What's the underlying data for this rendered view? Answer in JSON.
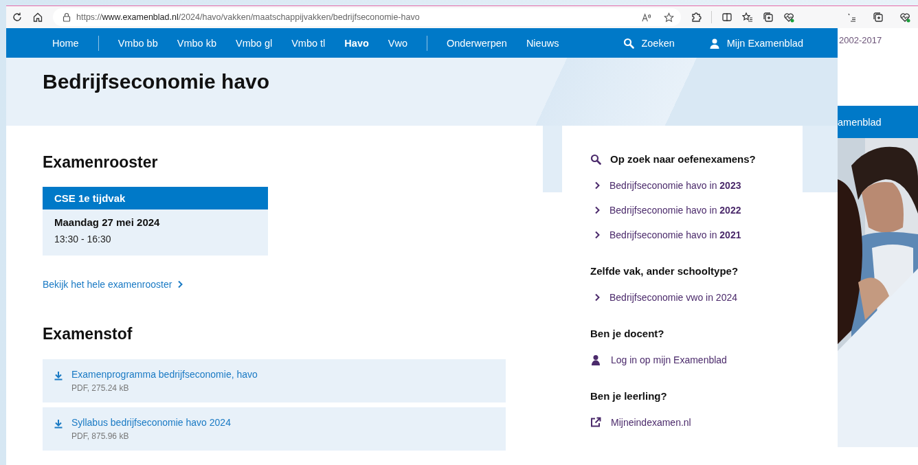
{
  "browser": {
    "url_scheme": "https://",
    "url_host": "www.examenblad.nl",
    "url_path": "/2024/havo/vakken/maatschappijvakken/bedrijfseconomie-havo"
  },
  "nav": {
    "groups": [
      [
        {
          "label": "Home",
          "selected": false
        }
      ],
      [
        {
          "label": "Vmbo bb",
          "selected": false
        },
        {
          "label": "Vmbo kb",
          "selected": false
        },
        {
          "label": "Vmbo gl",
          "selected": false
        },
        {
          "label": "Vmbo tl",
          "selected": false
        },
        {
          "label": "Havo",
          "selected": true
        },
        {
          "label": "Vwo",
          "selected": false
        }
      ],
      [
        {
          "label": "Onderwerpen",
          "selected": false
        },
        {
          "label": "Nieuws",
          "selected": false
        }
      ]
    ],
    "search": "Zoeken",
    "account": "Mijn Examenblad"
  },
  "title": "Bedrijfseconomie havo",
  "schedule": {
    "heading": "Examenrooster",
    "card_title": "CSE 1e tijdvak",
    "date": "Maandag 27 mei 2024",
    "time": "13:30 - 16:30",
    "link": "Bekijk het hele examenrooster"
  },
  "materials": {
    "heading": "Examenstof",
    "files": [
      {
        "title": "Examenprogramma bedrijfseconomie, havo",
        "meta": "PDF, 275.24 kB"
      },
      {
        "title": "Syllabus bedrijfseconomie havo 2024",
        "meta": "PDF, 875.96 kB"
      }
    ]
  },
  "sidebar": [
    {
      "heading": "Op zoek naar oefenexamens?",
      "kind": "search",
      "links": [
        {
          "text": "Bedrijfseconomie havo in **2023**",
          "kind": "chevron"
        },
        {
          "text": "Bedrijfseconomie havo in **2022**",
          "kind": "chevron"
        },
        {
          "text": "Bedrijfseconomie havo in **2021**",
          "kind": "chevron"
        }
      ]
    },
    {
      "heading": "Zelfde vak, ander schooltype?",
      "kind": "plain",
      "links": [
        {
          "text": "Bedrijfseconomie vwo in 2024",
          "kind": "chevron"
        }
      ]
    },
    {
      "heading": "Ben je docent?",
      "kind": "plain",
      "links": [
        {
          "text": "Log in op mijn Examenblad",
          "kind": "person"
        }
      ]
    },
    {
      "heading": "Ben je leerling?",
      "kind": "plain",
      "links": [
        {
          "text": "Mijneindexamen.nl",
          "kind": "external"
        }
      ]
    }
  ],
  "back_window": {
    "text": "2002-2017",
    "banner": "amenblad"
  }
}
